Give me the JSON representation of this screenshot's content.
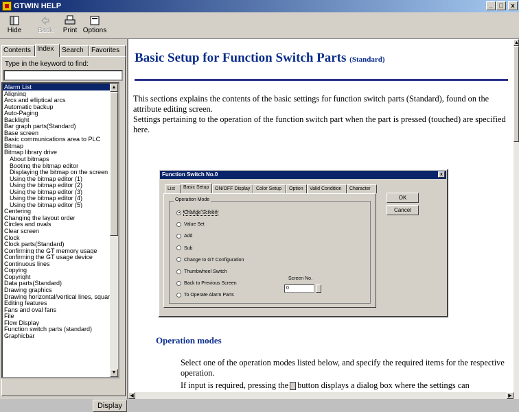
{
  "window": {
    "title": "GTWIN HELP",
    "min_label": "_",
    "max_label": "□",
    "close_label": "x"
  },
  "toolbar": {
    "hide": "Hide",
    "back": "Back",
    "print": "Print",
    "options": "Options"
  },
  "left": {
    "tabs": [
      "Contents",
      "Index",
      "Search",
      "Favorites"
    ],
    "active_tab": "Index",
    "keyword_label": "Type in the keyword to find:",
    "keyword_value": "",
    "display_button": "Display",
    "items": [
      {
        "text": "Alarm List",
        "selected": true
      },
      {
        "text": "Aligning"
      },
      {
        "text": "Arcs and elliptical arcs"
      },
      {
        "text": "Automatic backup"
      },
      {
        "text": "Auto-Paging"
      },
      {
        "text": "Backlight"
      },
      {
        "text": "Bar graph parts(Standard)"
      },
      {
        "text": "Base screen"
      },
      {
        "text": "Basic communications area to PLC"
      },
      {
        "text": "Bitmap"
      },
      {
        "text": "Bitmap library drive"
      },
      {
        "text": "About bitmaps",
        "sub": true
      },
      {
        "text": "Booting the bitmap editor",
        "sub": true
      },
      {
        "text": "Displaying the bitmap on the screen",
        "sub": true
      },
      {
        "text": "Using the bitmap editor (1)",
        "sub": true
      },
      {
        "text": "Using the bitmap editor (2)",
        "sub": true
      },
      {
        "text": "Using the bitmap editor (3)",
        "sub": true
      },
      {
        "text": "Using the bitmap editor (4)",
        "sub": true
      },
      {
        "text": "Using the bitmap editor (5)",
        "sub": true
      },
      {
        "text": "Centering"
      },
      {
        "text": "Changing the layout order"
      },
      {
        "text": "Circles and ovals"
      },
      {
        "text": "Clear screen"
      },
      {
        "text": "Clock"
      },
      {
        "text": "Clock parts(Standard)"
      },
      {
        "text": "Confirming the GT memory usage"
      },
      {
        "text": "Confirming the GT usage device"
      },
      {
        "text": "Continuous lines"
      },
      {
        "text": "Copying"
      },
      {
        "text": "Copyright"
      },
      {
        "text": "Data parts(Standard)"
      },
      {
        "text": "Drawing graphics"
      },
      {
        "text": "Drawing horizontal/vertical lines, squares"
      },
      {
        "text": "Editing features"
      },
      {
        "text": "Fans and oval fans"
      },
      {
        "text": "File"
      },
      {
        "text": "Flow Display"
      },
      {
        "text": "Function switch parts (standard)"
      },
      {
        "text": "Graphicbar"
      }
    ]
  },
  "content": {
    "title": "Basic Setup for Function Switch Parts",
    "title_suffix": "(Standard)",
    "intro": "This sections explains the contents of the basic settings for function switch parts (Standard), found on the attribute editing screen.",
    "intro2": "Settings pertaining to the operation of the function switch part when the part is pressed (touched) are specified here.",
    "section_heading": "Operation modes",
    "para": "Select one of the operation modes listed below, and specify the required items for the respective operation.",
    "para_prefix": "If input is required, pressing the",
    "para_suffix": "button displays a dialog box where the settings can"
  },
  "dialog": {
    "title": "Function Switch No.0",
    "close": "x",
    "tabs": [
      "List",
      "Basic Setup",
      "ON/OFF Display",
      "Color Setup",
      "Option",
      "Valid Condition",
      "Character"
    ],
    "active_tab": "Basic Setup",
    "group_label": "Operation Mode",
    "radios": [
      {
        "label": "Change Screen",
        "checked": true
      },
      {
        "label": "Value Set"
      },
      {
        "label": "Add"
      },
      {
        "label": "Sub"
      },
      {
        "label": "Change to GT Configuration"
      },
      {
        "label": "Thumbwheel Switch"
      },
      {
        "label": "Back to Previous Screen"
      },
      {
        "label": "To Operate Alarm Parts"
      }
    ],
    "screen_no_label": "Screen No.",
    "screen_no_value": "0",
    "ok": "OK",
    "cancel": "Cancel"
  }
}
